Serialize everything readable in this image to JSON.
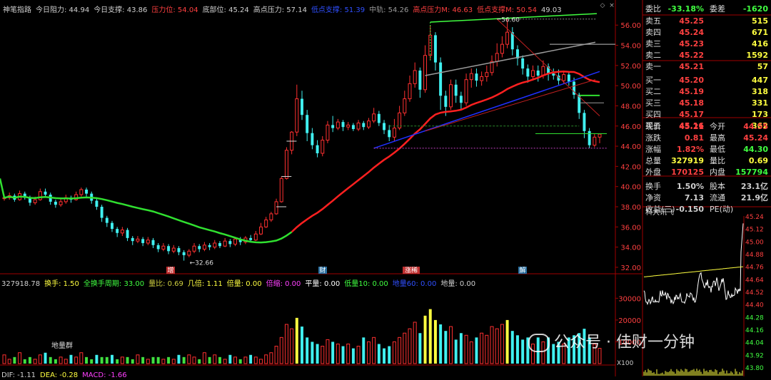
{
  "header": {
    "items": [
      {
        "label": "神笔指路",
        "color": "#d0d0d0"
      },
      {
        "label": "今日阻力: 44.94",
        "color": "#d0d0d0"
      },
      {
        "label": "今日支撑: 43.86",
        "color": "#d0d0d0"
      },
      {
        "label": "压力位: 54.04",
        "color": "#ff4040"
      },
      {
        "label": "底部位: 45.24",
        "color": "#d0d0d0"
      },
      {
        "label": "高点压力: 57.14",
        "color": "#d0d0d0"
      },
      {
        "label": "低点支撑: 51.39",
        "color": "#2f4fff"
      },
      {
        "label": "中轨: 54.26",
        "color": "#9a9a9a"
      },
      {
        "label": "高点压力M: 46.63",
        "color": "#ff4040"
      },
      {
        "label": "低点支撑M: 50.54",
        "color": "#ff4040"
      },
      {
        "label": "49.03",
        "color": "#d0d0d0"
      }
    ],
    "buttons": [
      "◇",
      "×"
    ]
  },
  "price_axis": [
    "56.00",
    "54.00",
    "52.00",
    "50.00",
    "48.00",
    "46.00",
    "44.00",
    "42.00",
    "40.00",
    "38.00",
    "36.00",
    "34.00",
    "32.00"
  ],
  "annotations": {
    "high": "56.60",
    "low": "32.66"
  },
  "event_tags": [
    {
      "label": "增",
      "bg": "#c03030"
    },
    {
      "label": "财",
      "bg": "#2a6fa0"
    },
    {
      "label": "涨稀",
      "bg": "#c03030"
    },
    {
      "label": "解",
      "bg": "#2a6fa0"
    }
  ],
  "indicator_line": [
    {
      "label": "327918.78",
      "color": "#d0d0d0"
    },
    {
      "label": "换手: 1.50",
      "color": "#ffff40"
    },
    {
      "label": "全换手周期: 33.00",
      "color": "#40ff40"
    },
    {
      "label": "量比: 0.69",
      "color": "#d0d040"
    },
    {
      "label": "几倍: 1.11",
      "color": "#ffff40"
    },
    {
      "label": "倍量: 0.00",
      "color": "#ffff40"
    },
    {
      "label": "倍缩: 0.00",
      "color": "#ff40ff"
    },
    {
      "label": "平量: 0.00",
      "color": "#ffffff"
    },
    {
      "label": "低量10: 0.00",
      "color": "#40ff40"
    },
    {
      "label": "地量60: 0.00",
      "color": "#2f4fff"
    },
    {
      "label": "地量: 0.00",
      "color": "#d0d0d0"
    }
  ],
  "volume_axis": [
    "30000",
    "20000",
    "10000"
  ],
  "volume_unit": "X100",
  "volume_note": "地量群",
  "macd_line": [
    {
      "label": "DIF: -1.11",
      "color": "#d0d0d0"
    },
    {
      "label": "DEA: -0.28",
      "color": "#ffff40"
    },
    {
      "label": "MACD: -1.66",
      "color": "#ff40ff"
    }
  ],
  "order_book": {
    "weibi": {
      "label": "委比",
      "value": "-33.18%",
      "label2": "委差",
      "value2": "-1620"
    },
    "asks": [
      {
        "label": "卖五",
        "price": "45.25",
        "vol": "515"
      },
      {
        "label": "卖四",
        "price": "45.24",
        "vol": "671"
      },
      {
        "label": "卖三",
        "price": "45.23",
        "vol": "416"
      },
      {
        "label": "卖二",
        "price": "45.22",
        "vol": "1592"
      },
      {
        "label": "卖一",
        "price": "45.21",
        "vol": "57"
      }
    ],
    "bids": [
      {
        "label": "买一",
        "price": "45.20",
        "vol": "447"
      },
      {
        "label": "买二",
        "price": "45.19",
        "vol": "318"
      },
      {
        "label": "买三",
        "price": "45.18",
        "vol": "331"
      },
      {
        "label": "买四",
        "price": "45.17",
        "vol": "173"
      },
      {
        "label": "买五",
        "price": "45.16",
        "vol": "362"
      }
    ]
  },
  "stats": [
    {
      "l1": "现价",
      "v1": "45.21",
      "c1": "#ff4040",
      "l2": "今开",
      "v2": "44.55",
      "c2": "#ff4040"
    },
    {
      "l1": "涨跌",
      "v1": "0.81",
      "c1": "#ff4040",
      "l2": "最高",
      "v2": "45.24",
      "c2": "#ff4040"
    },
    {
      "l1": "涨幅",
      "v1": "1.82%",
      "c1": "#ff4040",
      "l2": "最低",
      "v2": "44.30",
      "c2": "#40ff40"
    },
    {
      "l1": "总量",
      "v1": "327919",
      "c1": "#ffff40",
      "l2": "量比",
      "v2": "0.69",
      "c2": "#ffff40"
    },
    {
      "l1": "外盘",
      "v1": "170125",
      "c1": "#ff4040",
      "l2": "内盘",
      "v2": "157794",
      "c2": "#40ff40"
    },
    {
      "l1": "换手",
      "v1": "1.50%",
      "c1": "#d0d0d0",
      "l2": "股本",
      "v2": "23.1亿",
      "c2": "#d0d0d0"
    },
    {
      "l1": "净资",
      "v1": "7.13",
      "c1": "#d0d0d0",
      "l2": "流通",
      "v2": "21.9亿",
      "c2": "#d0d0d0"
    },
    {
      "l1": "收益(三)",
      "v1": "-0.150",
      "c1": "#d0d0d0",
      "l2": "PE(动)",
      "v2": "",
      "c2": "#d0d0d0"
    }
  ],
  "intraday": {
    "title": "科大讯飞",
    "axis": [
      "45.24",
      "45.12",
      "45.00",
      "44.88",
      "44.76",
      "44.64",
      "44.52",
      "44.40",
      "44.28",
      "44.16",
      "44.04",
      "43.92",
      "43.80"
    ]
  },
  "watermark": "公众号 · 佳财一分钟",
  "colors": {
    "up": "#ff3030",
    "down": "#40f0f0",
    "ma_green": "#30e030",
    "ma_red": "#ff2020",
    "blue": "#2030ff",
    "grid": "#800000"
  },
  "chart_data": {
    "type": "candlestick",
    "ylim": [
      31.5,
      57.5
    ],
    "candles": [
      [
        38.8,
        38.9,
        38.6,
        39.2
      ],
      [
        38.9,
        39.1,
        38.7,
        39.4
      ],
      [
        39.1,
        38.7,
        38.5,
        39.3
      ],
      [
        38.7,
        39.3,
        38.6,
        39.6
      ],
      [
        39.3,
        38.9,
        38.7,
        39.5
      ],
      [
        38.9,
        38.4,
        38.1,
        39.1
      ],
      [
        38.4,
        38.7,
        38.2,
        39.0
      ],
      [
        38.7,
        39.5,
        38.6,
        39.8
      ],
      [
        39.5,
        39.2,
        38.9,
        39.8
      ],
      [
        39.2,
        38.5,
        38.2,
        39.4
      ],
      [
        38.5,
        38.2,
        37.9,
        38.7
      ],
      [
        38.2,
        38.5,
        38.0,
        38.8
      ],
      [
        38.5,
        38.9,
        38.3,
        39.2
      ],
      [
        38.9,
        38.7,
        38.4,
        39.1
      ],
      [
        38.7,
        39.2,
        38.6,
        39.5
      ],
      [
        39.2,
        39.7,
        39.0,
        39.9
      ],
      [
        39.7,
        39.3,
        39.0,
        39.9
      ],
      [
        39.3,
        38.6,
        38.3,
        39.5
      ],
      [
        38.6,
        38.0,
        37.7,
        38.8
      ],
      [
        38.0,
        36.9,
        36.5,
        38.2
      ],
      [
        36.9,
        36.4,
        36.0,
        37.1
      ],
      [
        36.4,
        35.8,
        35.5,
        36.6
      ],
      [
        35.8,
        35.4,
        35.0,
        36.0
      ],
      [
        35.4,
        35.7,
        35.1,
        36.0
      ],
      [
        35.7,
        34.9,
        34.6,
        35.9
      ],
      [
        34.9,
        34.6,
        34.2,
        35.1
      ],
      [
        34.6,
        34.8,
        34.4,
        35.1
      ],
      [
        34.8,
        34.4,
        34.1,
        35.0
      ],
      [
        34.4,
        34.7,
        34.2,
        35.0
      ],
      [
        34.7,
        34.2,
        33.9,
        34.9
      ],
      [
        34.2,
        33.8,
        33.5,
        34.4
      ],
      [
        33.8,
        34.1,
        33.6,
        34.4
      ],
      [
        34.1,
        33.6,
        33.3,
        34.3
      ],
      [
        33.6,
        33.9,
        33.4,
        34.2
      ],
      [
        33.9,
        33.5,
        33.2,
        34.1
      ],
      [
        33.5,
        33.2,
        32.66,
        33.7
      ],
      [
        33.2,
        33.6,
        33.0,
        33.8
      ],
      [
        33.6,
        34.1,
        33.4,
        34.4
      ],
      [
        34.1,
        33.8,
        33.5,
        34.3
      ],
      [
        33.8,
        34.2,
        33.6,
        34.5
      ],
      [
        34.2,
        34.0,
        33.7,
        34.4
      ],
      [
        34.0,
        34.4,
        33.8,
        34.7
      ],
      [
        34.4,
        34.1,
        33.9,
        34.6
      ],
      [
        34.1,
        34.6,
        34.0,
        34.9
      ],
      [
        34.6,
        34.3,
        34.0,
        34.8
      ],
      [
        34.3,
        34.8,
        34.1,
        35.0
      ],
      [
        34.8,
        34.5,
        34.2,
        35.0
      ],
      [
        34.5,
        34.9,
        34.3,
        35.1
      ],
      [
        34.9,
        34.7,
        34.5,
        35.2
      ],
      [
        34.7,
        35.3,
        34.6,
        35.6
      ],
      [
        35.3,
        36.0,
        35.2,
        36.4
      ],
      [
        36.0,
        36.7,
        35.9,
        37.0
      ],
      [
        36.7,
        37.3,
        36.5,
        37.5
      ],
      [
        37.3,
        38.5,
        37.2,
        38.8
      ],
      [
        38.5,
        40.8,
        38.4,
        41.0
      ],
      [
        40.8,
        43.6,
        40.7,
        43.9
      ],
      [
        43.6,
        45.4,
        43.2,
        45.5
      ],
      [
        45.4,
        48.7,
        45.0,
        50.1
      ],
      [
        48.7,
        47.1,
        46.6,
        49.5
      ],
      [
        47.1,
        45.3,
        44.5,
        47.6
      ],
      [
        45.3,
        44.1,
        43.7,
        45.8
      ],
      [
        44.1,
        43.3,
        42.9,
        44.6
      ],
      [
        43.3,
        44.6,
        43.0,
        45.0
      ],
      [
        44.6,
        46.1,
        44.3,
        46.5
      ],
      [
        46.1,
        45.8,
        45.4,
        47.0
      ],
      [
        45.8,
        46.4,
        45.6,
        46.7
      ],
      [
        46.4,
        45.9,
        45.5,
        46.6
      ],
      [
        45.9,
        46.1,
        45.6,
        46.4
      ],
      [
        46.1,
        45.7,
        45.5,
        46.3
      ],
      [
        45.7,
        46.3,
        45.5,
        46.6
      ],
      [
        46.3,
        45.9,
        45.6,
        46.5
      ],
      [
        45.9,
        46.5,
        45.7,
        46.8
      ],
      [
        46.5,
        47.2,
        46.3,
        47.8
      ],
      [
        47.2,
        46.3,
        46.0,
        47.5
      ],
      [
        46.3,
        45.6,
        45.2,
        46.6
      ],
      [
        45.6,
        44.9,
        44.5,
        46.1
      ],
      [
        44.9,
        45.8,
        44.5,
        46.7
      ],
      [
        45.8,
        47.3,
        45.6,
        48.0
      ],
      [
        47.3,
        48.7,
        47.0,
        49.5
      ],
      [
        48.7,
        50.2,
        48.4,
        51.0
      ],
      [
        50.2,
        51.5,
        49.8,
        52.3
      ],
      [
        51.5,
        49.6,
        48.8,
        51.8
      ],
      [
        49.6,
        53.0,
        49.3,
        54.0
      ],
      [
        53.0,
        55.0,
        52.6,
        56.0
      ],
      [
        55.0,
        52.3,
        51.5,
        55.3
      ],
      [
        52.3,
        49.0,
        47.6,
        52.8
      ],
      [
        49.0,
        47.9,
        47.0,
        49.5
      ],
      [
        47.9,
        50.1,
        47.6,
        50.6
      ],
      [
        50.1,
        49.0,
        48.3,
        50.6
      ],
      [
        49.0,
        48.3,
        47.6,
        49.4
      ],
      [
        48.3,
        50.6,
        48.0,
        51.2
      ],
      [
        50.6,
        51.2,
        49.8,
        51.7
      ],
      [
        51.2,
        50.5,
        49.9,
        51.7
      ],
      [
        50.5,
        50.9,
        50.0,
        51.4
      ],
      [
        50.9,
        51.3,
        50.4,
        52.0
      ],
      [
        51.3,
        52.4,
        51.0,
        53.0
      ],
      [
        52.4,
        53.2,
        51.9,
        54.2
      ],
      [
        53.2,
        54.1,
        52.8,
        54.9
      ],
      [
        54.1,
        55.3,
        53.7,
        56.6
      ],
      [
        55.3,
        53.6,
        53.0,
        55.8
      ],
      [
        53.6,
        52.7,
        52.0,
        54.0
      ],
      [
        52.7,
        51.7,
        51.1,
        53.0
      ],
      [
        51.7,
        50.9,
        50.3,
        52.1
      ],
      [
        50.9,
        51.5,
        50.5,
        52.0
      ],
      [
        51.5,
        51.0,
        50.4,
        52.0
      ],
      [
        51.0,
        51.9,
        50.7,
        52.5
      ],
      [
        51.9,
        51.2,
        50.5,
        52.2
      ],
      [
        51.2,
        51.0,
        50.6,
        51.7
      ],
      [
        51.0,
        50.5,
        50.1,
        51.6
      ],
      [
        50.5,
        51.1,
        50.2,
        51.5
      ],
      [
        51.1,
        50.4,
        50.0,
        51.3
      ],
      [
        50.4,
        49.1,
        48.7,
        50.8
      ],
      [
        49.1,
        47.3,
        46.7,
        49.3
      ],
      [
        47.3,
        45.5,
        44.8,
        47.6
      ],
      [
        45.5,
        44.1,
        43.8,
        45.8
      ],
      [
        44.1,
        44.9,
        43.9,
        45.2
      ],
      [
        44.9,
        45.2,
        44.3,
        45.24
      ]
    ],
    "volume": [
      4,
      2,
      3,
      5,
      2,
      3,
      2,
      4,
      5,
      3,
      2,
      3,
      2,
      4,
      3,
      5,
      3,
      2,
      4,
      3,
      3,
      4,
      2,
      3,
      3,
      2,
      4,
      3,
      2,
      3,
      3,
      2,
      3,
      2,
      4,
      3,
      4,
      3,
      2,
      5,
      3,
      4,
      3,
      2,
      4,
      3,
      2,
      3,
      4,
      3,
      2,
      4,
      5,
      8,
      12,
      18,
      16,
      21,
      17,
      12,
      10,
      9,
      8,
      11,
      10,
      9,
      8,
      9,
      7,
      8,
      12,
      10,
      12,
      9,
      7,
      8,
      10,
      12,
      14,
      16,
      19,
      14,
      22,
      25,
      20,
      18,
      15,
      17,
      11,
      14,
      13,
      10,
      12,
      14,
      13,
      17,
      16,
      18,
      20,
      15,
      13,
      11,
      12,
      9,
      12,
      10,
      12,
      9,
      10,
      9,
      12,
      13,
      14,
      16,
      12,
      9,
      7
    ],
    "volume_ylim": [
      0,
      36000
    ]
  }
}
